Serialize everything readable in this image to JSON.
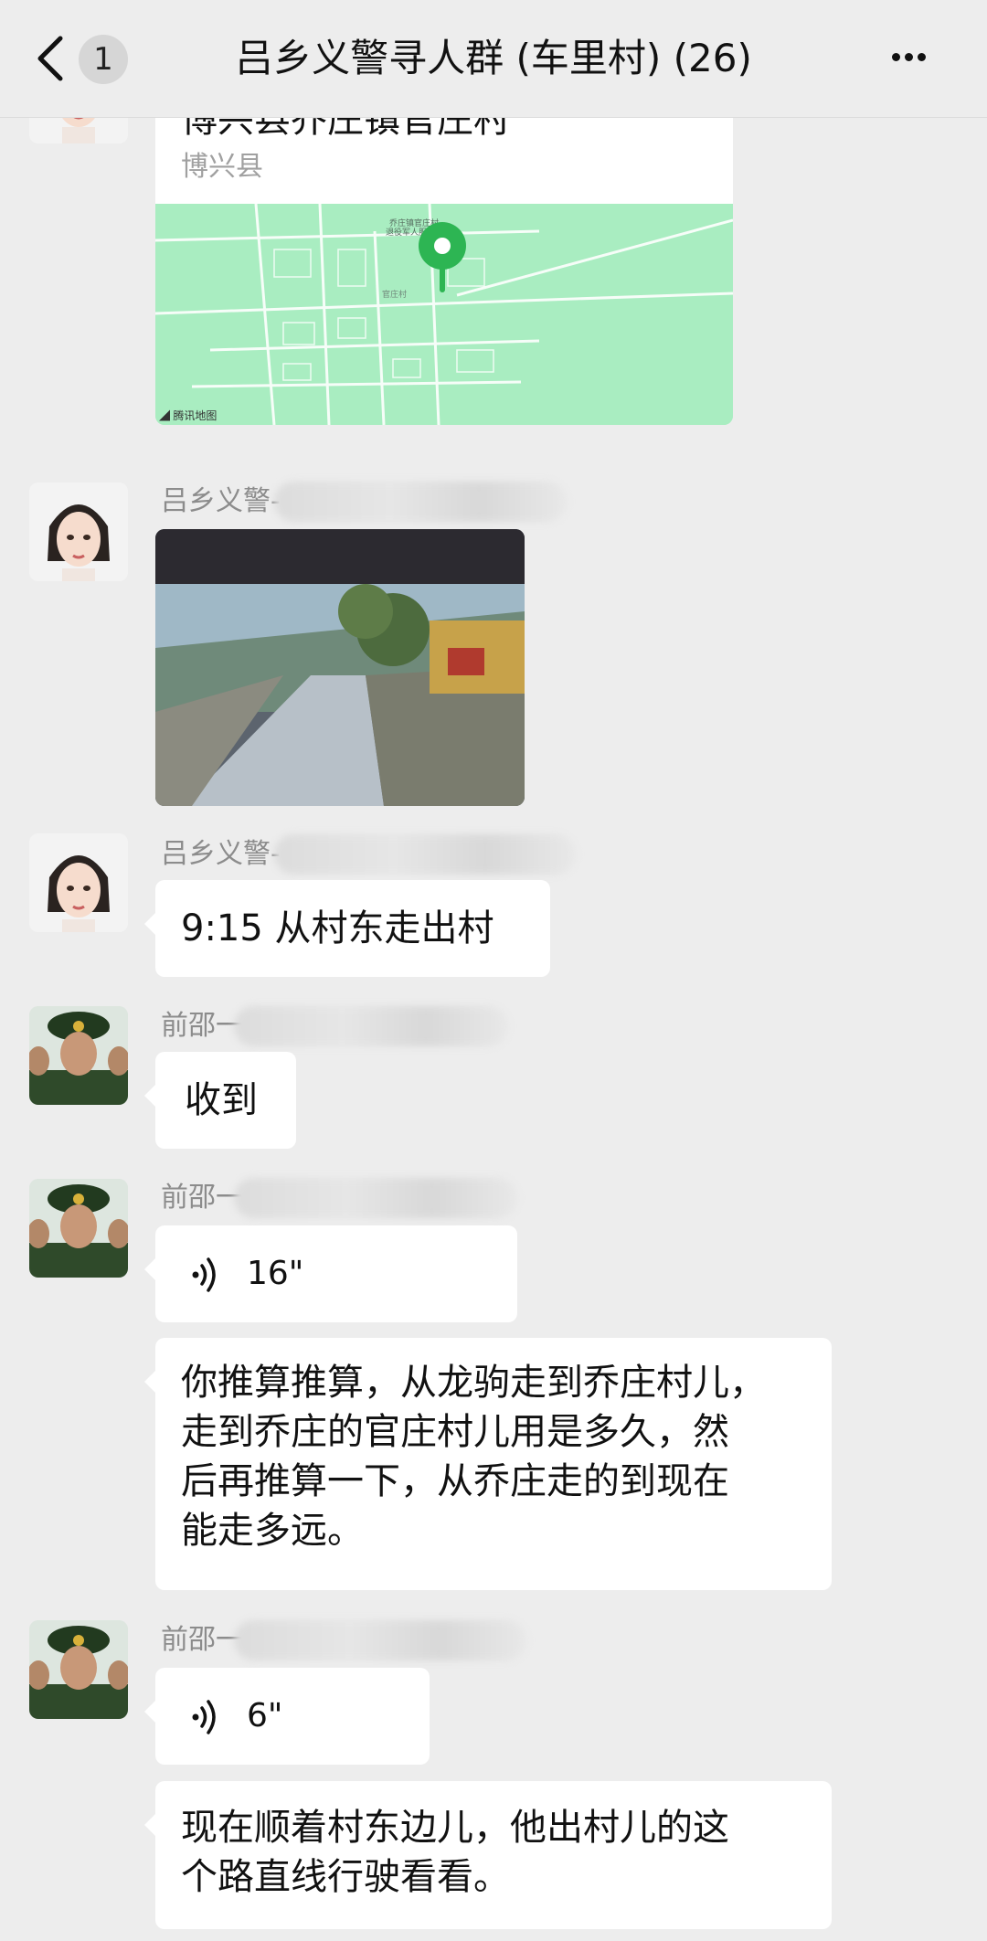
{
  "header": {
    "back_icon": "chevron-left-icon",
    "unread_count": "1",
    "title": "吕乡义警寻人群 (车里村) (26)",
    "more_icon": "more-dots-icon"
  },
  "messages": [
    {
      "type": "location",
      "title": "博兴县乔庄镇官庄村",
      "subtitle": "博兴县",
      "map_pin_label": "乔庄镇官庄村\n退役军人服",
      "map_village_label": "官庄村",
      "map_attribution": "腾讯地图"
    },
    {
      "type": "image",
      "sender": "吕乡义警-"
    },
    {
      "type": "text",
      "sender": "吕乡义警-",
      "text": "9:15 从村东走出村"
    },
    {
      "type": "text",
      "sender": "前邵一",
      "text": "收到"
    },
    {
      "type": "voice",
      "sender": "前邵一",
      "duration": "16\""
    },
    {
      "type": "text",
      "sender": "",
      "lines": [
        "你推算推算，从龙驹走到乔庄村儿，",
        "走到乔庄的官庄村儿用是多久，然",
        "后再推算一下，从乔庄走的到现在",
        "能走多远。"
      ]
    },
    {
      "type": "voice",
      "sender": "前邵一",
      "duration": "6\""
    },
    {
      "type": "text",
      "sender": "",
      "lines": [
        "现在顺着村东边儿，他出村儿的这",
        "个路直线行驶看看。"
      ]
    }
  ],
  "colors": {
    "background": "#ededed",
    "bubble": "#ffffff",
    "map": "#a8ecc0",
    "pin": "#2db553"
  }
}
